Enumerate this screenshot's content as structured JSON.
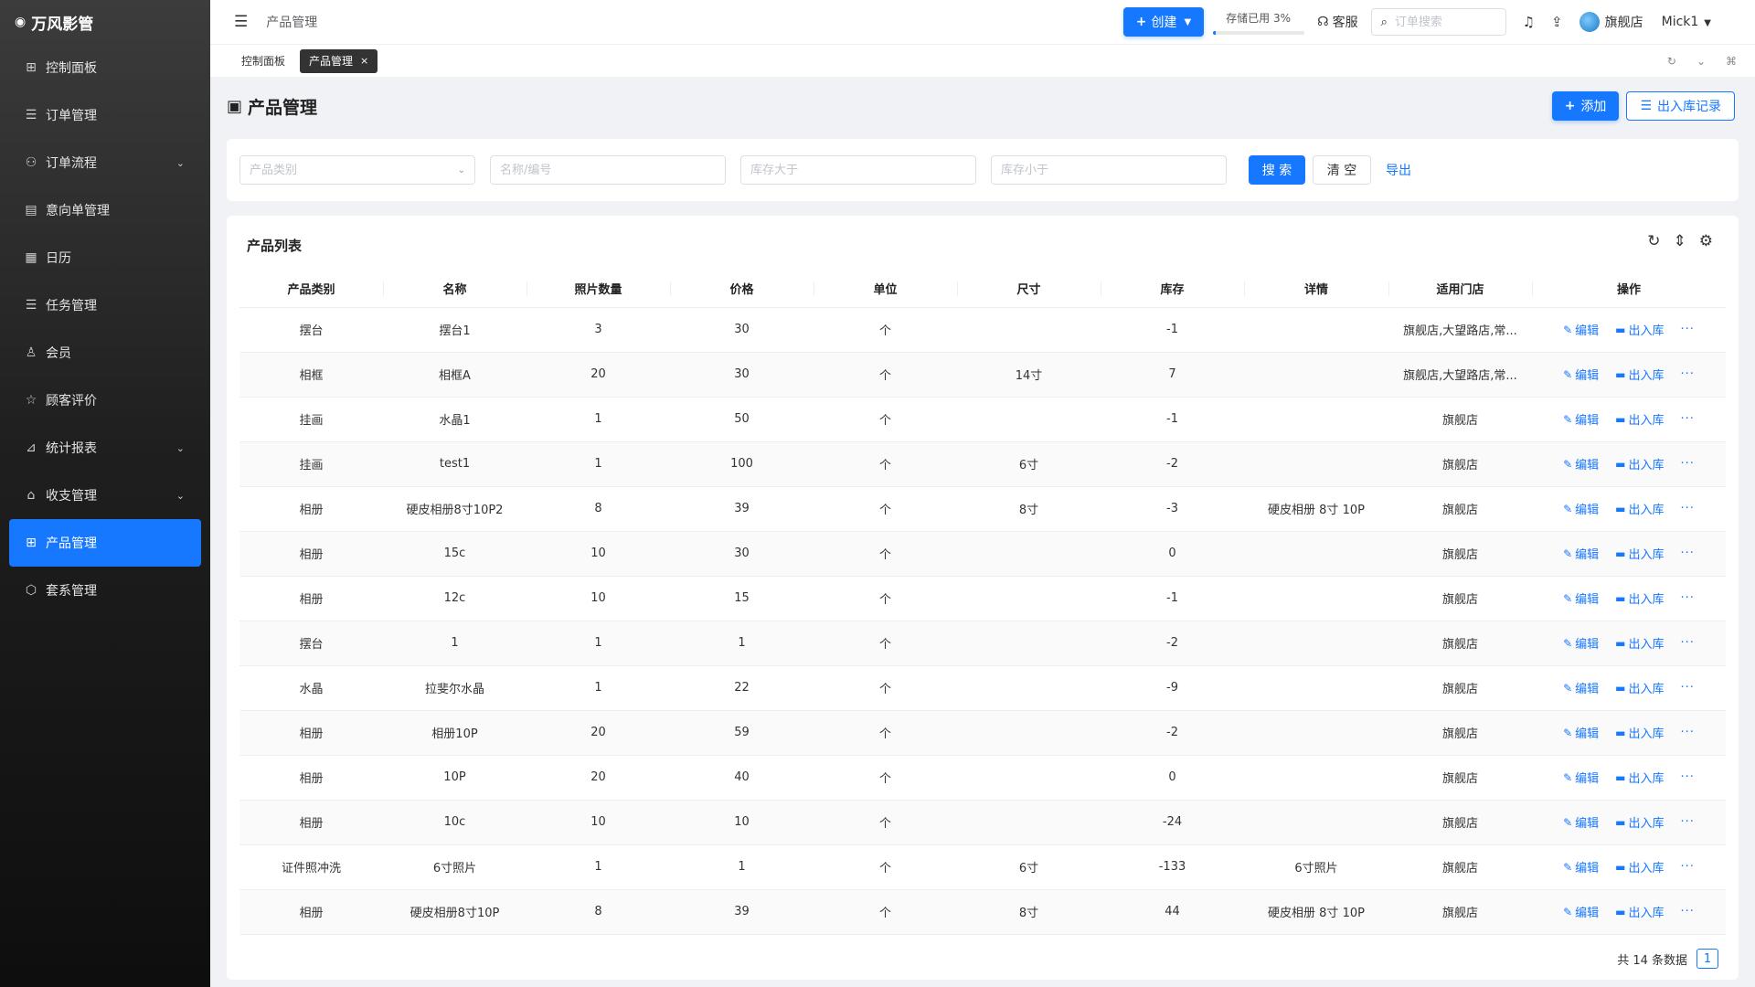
{
  "app": {
    "brand": "万风影管"
  },
  "sidebar": {
    "items": [
      {
        "label": "控制面板",
        "icon": "dashboard-icon",
        "glyph": "⊞",
        "arrow": false,
        "active": false
      },
      {
        "label": "订单管理",
        "icon": "list-icon",
        "glyph": "☰",
        "arrow": false,
        "active": false
      },
      {
        "label": "订单流程",
        "icon": "flow-icon",
        "glyph": "⚇",
        "arrow": true,
        "active": false
      },
      {
        "label": "意向单管理",
        "icon": "clipboard-icon",
        "glyph": "▤",
        "arrow": false,
        "active": false
      },
      {
        "label": "日历",
        "icon": "calendar-icon",
        "glyph": "▦",
        "arrow": false,
        "active": false
      },
      {
        "label": "任务管理",
        "icon": "task-icon",
        "glyph": "☰",
        "arrow": false,
        "active": false
      },
      {
        "label": "会员",
        "icon": "user-icon",
        "glyph": "♙",
        "arrow": false,
        "active": false
      },
      {
        "label": "顾客评价",
        "icon": "star-icon",
        "glyph": "☆",
        "arrow": false,
        "active": false
      },
      {
        "label": "统计报表",
        "icon": "chart-icon",
        "glyph": "⊿",
        "arrow": true,
        "active": false
      },
      {
        "label": "收支管理",
        "icon": "bank-icon",
        "glyph": "⌂",
        "arrow": true,
        "active": false
      },
      {
        "label": "产品管理",
        "icon": "grid-icon",
        "glyph": "⊞",
        "arrow": false,
        "active": true
      },
      {
        "label": "套系管理",
        "icon": "package-icon",
        "glyph": "⬡",
        "arrow": false,
        "active": false
      }
    ]
  },
  "header": {
    "breadcrumb": "产品管理",
    "create_label": "创建",
    "storage_label": "存储已用 3%",
    "storage_percent": 3,
    "support_label": "客服",
    "search_placeholder": "订单搜索",
    "store_name": "旗舰店",
    "user_name": "Mick1"
  },
  "tabs": [
    {
      "label": "控制面板",
      "active": false
    },
    {
      "label": "产品管理",
      "active": true
    }
  ],
  "page": {
    "title": "产品管理",
    "add_label": "添加",
    "records_label": "出入库记录"
  },
  "filters": {
    "category_placeholder": "产品类别",
    "name_placeholder": "名称/编号",
    "stock_gt_placeholder": "库存大于",
    "stock_lt_placeholder": "库存小于",
    "search_label": "搜 索",
    "clear_label": "清 空",
    "export_label": "导出"
  },
  "table": {
    "title": "产品列表",
    "columns": [
      "产品类别",
      "名称",
      "照片数量",
      "价格",
      "单位",
      "尺寸",
      "库存",
      "详情",
      "适用门店",
      "操作"
    ],
    "edit_label": "编辑",
    "stock_label": "出入库",
    "more_label": "···",
    "rows": [
      {
        "category": "摆台",
        "name": "摆台1",
        "photos": "3",
        "price": "30",
        "unit": "个",
        "size": "",
        "stock": "-1",
        "detail": "",
        "store": "旗舰店,大望路店,常..."
      },
      {
        "category": "相框",
        "name": "相框A",
        "photos": "20",
        "price": "30",
        "unit": "个",
        "size": "14寸",
        "stock": "7",
        "detail": "",
        "store": "旗舰店,大望路店,常..."
      },
      {
        "category": "挂画",
        "name": "水晶1",
        "photos": "1",
        "price": "50",
        "unit": "个",
        "size": "",
        "stock": "-1",
        "detail": "",
        "store": "旗舰店"
      },
      {
        "category": "挂画",
        "name": "test1",
        "photos": "1",
        "price": "100",
        "unit": "个",
        "size": "6寸",
        "stock": "-2",
        "detail": "",
        "store": "旗舰店"
      },
      {
        "category": "相册",
        "name": "硬皮相册8寸10P2",
        "photos": "8",
        "price": "39",
        "unit": "个",
        "size": "8寸",
        "stock": "-3",
        "detail": "硬皮相册 8寸 10P",
        "store": "旗舰店"
      },
      {
        "category": "相册",
        "name": "15c",
        "photos": "10",
        "price": "30",
        "unit": "个",
        "size": "",
        "stock": "0",
        "detail": "",
        "store": "旗舰店"
      },
      {
        "category": "相册",
        "name": "12c",
        "photos": "10",
        "price": "15",
        "unit": "个",
        "size": "",
        "stock": "-1",
        "detail": "",
        "store": "旗舰店"
      },
      {
        "category": "摆台",
        "name": "1",
        "photos": "1",
        "price": "1",
        "unit": "个",
        "size": "",
        "stock": "-2",
        "detail": "",
        "store": "旗舰店"
      },
      {
        "category": "水晶",
        "name": "拉斐尔水晶",
        "photos": "1",
        "price": "22",
        "unit": "个",
        "size": "",
        "stock": "-9",
        "detail": "",
        "store": "旗舰店"
      },
      {
        "category": "相册",
        "name": "相册10P",
        "photos": "20",
        "price": "59",
        "unit": "个",
        "size": "",
        "stock": "-2",
        "detail": "",
        "store": "旗舰店"
      },
      {
        "category": "相册",
        "name": "10P",
        "photos": "20",
        "price": "40",
        "unit": "个",
        "size": "",
        "stock": "0",
        "detail": "",
        "store": "旗舰店"
      },
      {
        "category": "相册",
        "name": "10c",
        "photos": "10",
        "price": "10",
        "unit": "个",
        "size": "",
        "stock": "-24",
        "detail": "",
        "store": "旗舰店"
      },
      {
        "category": "证件照冲洗",
        "name": "6寸照片",
        "photos": "1",
        "price": "1",
        "unit": "个",
        "size": "6寸",
        "stock": "-133",
        "detail": "6寸照片",
        "store": "旗舰店"
      },
      {
        "category": "相册",
        "name": "硬皮相册8寸10P",
        "photos": "8",
        "price": "39",
        "unit": "个",
        "size": "8寸",
        "stock": "44",
        "detail": "硬皮相册 8寸 10P",
        "store": "旗舰店"
      }
    ],
    "total_label": "共 14 条数据",
    "current_page": "1"
  },
  "colors": {
    "primary": "#1677ff",
    "sidebar_bg": "#1f1f1f"
  }
}
